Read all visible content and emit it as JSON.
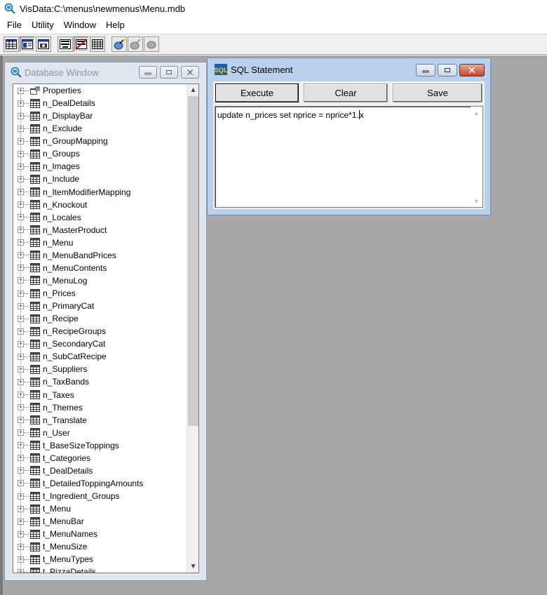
{
  "app": {
    "title": "VisData:C:\\menus\\newmenus\\Menu.mdb"
  },
  "menu": [
    "File",
    "Utility",
    "Window",
    "Help"
  ],
  "toolbar": {
    "buttons": [
      "table-view-icon",
      "dynaset-view-icon",
      "snapshot-view-icon",
      "form-control-icon",
      "no-data-control-icon",
      "grid-control-icon",
      "begin-transaction-icon",
      "commit-icon",
      "rollback-icon"
    ]
  },
  "db_window": {
    "title": "Database Window",
    "items": [
      "Properties",
      "n_DealDetails",
      "n_DisplayBar",
      "n_Exclude",
      "n_GroupMapping",
      "n_Groups",
      "n_Images",
      "n_Include",
      "n_ItemModifierMapping",
      "n_Knockout",
      "n_Locales",
      "n_MasterProduct",
      "n_Menu",
      "n_MenuBandPrices",
      "n_MenuContents",
      "n_MenuLog",
      "n_Prices",
      "n_PrimaryCat",
      "n_Recipe",
      "n_RecipeGroups",
      "n_SecondaryCat",
      "n_SubCatRecipe",
      "n_Suppliers",
      "n_TaxBands",
      "n_Taxes",
      "n_Themes",
      "n_Translate",
      "n_User",
      "t_BaseSizeToppings",
      "t_Categories",
      "t_DealDetails",
      "t_DetailedToppingAmounts",
      "t_Ingredient_Groups",
      "t_Menu",
      "t_MenuBar",
      "t_MenuNames",
      "t_MenuSize",
      "t_MenuTypes",
      "t_PizzaDetails"
    ]
  },
  "sql_window": {
    "title": "SQL Statement",
    "icon_text": "SQL",
    "buttons": {
      "execute": "Execute",
      "clear": "Clear",
      "save": "Save"
    },
    "text_before_caret": "update n_prices set nprice = nprice*1.",
    "text_after_caret": "x"
  }
}
